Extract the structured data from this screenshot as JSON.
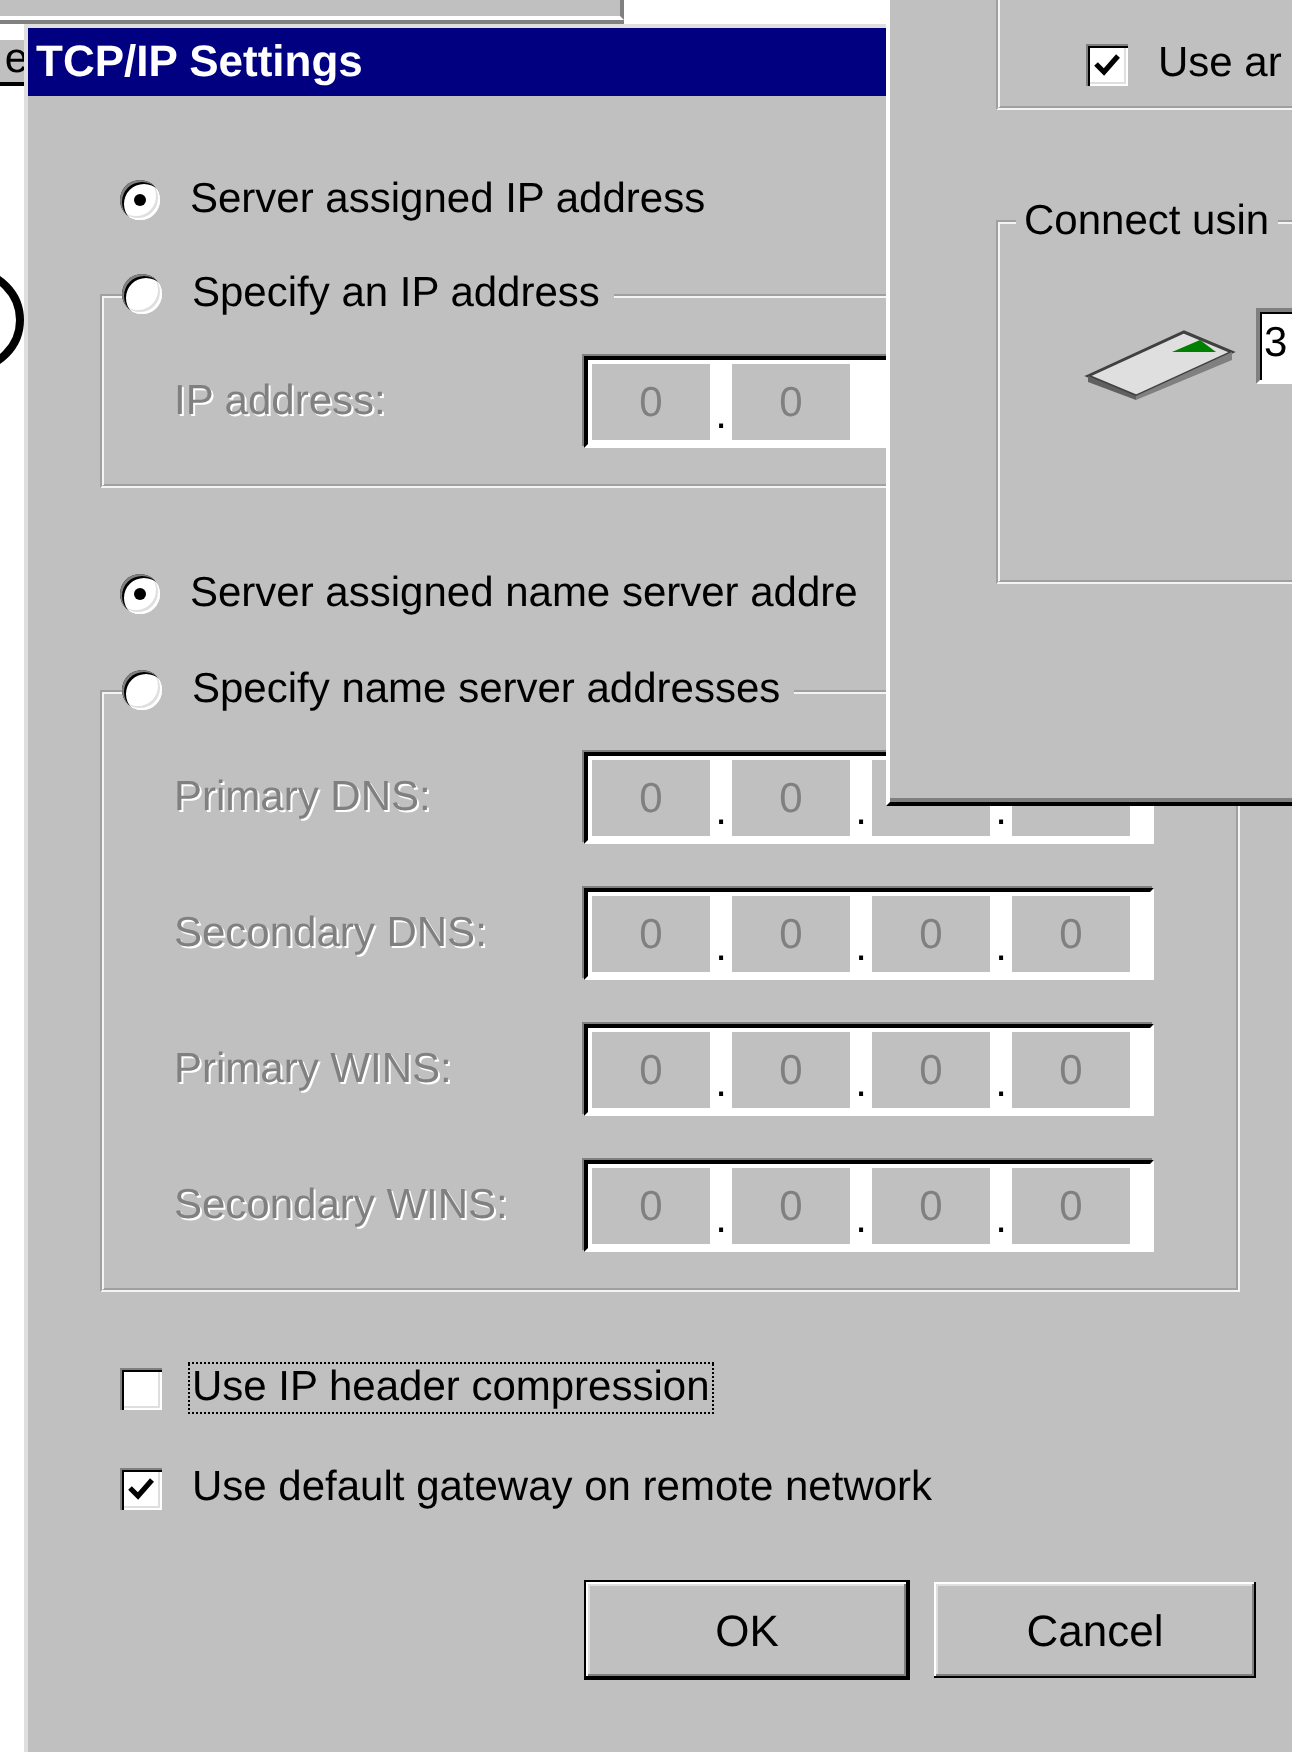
{
  "background_window": {
    "button": "e"
  },
  "dialog": {
    "title": "TCP/IP Settings",
    "ip_options": [
      {
        "label": "Server assigned IP address",
        "selected": true
      },
      {
        "label": "Specify an IP address",
        "selected": false
      }
    ],
    "ip_fields": [
      {
        "label": "IP address:",
        "disabled": true,
        "values": [
          "0",
          "0"
        ],
        "dots": [
          "."
        ]
      }
    ],
    "dns_options": [
      {
        "label": "Server assigned name server addre",
        "selected": true
      },
      {
        "label": "Specify name server addresses",
        "selected": false
      }
    ],
    "dns_fields": [
      {
        "label": "Primary DNS:",
        "disabled": true,
        "values": [
          "0",
          "0"
        ],
        "dots": [
          ".",
          ".",
          "."
        ]
      },
      {
        "label": "Secondary DNS:",
        "disabled": true,
        "values": [
          "0",
          "0",
          "0",
          "0"
        ],
        "dots": [
          ".",
          ".",
          "."
        ]
      },
      {
        "label": "Primary WINS:",
        "disabled": true,
        "values": [
          "0",
          "0",
          "0",
          "0"
        ],
        "dots": [
          ".",
          ".",
          "."
        ]
      },
      {
        "label": "Secondary WINS:",
        "disabled": true,
        "values": [
          "0",
          "0",
          "0",
          "0"
        ],
        "dots": [
          ".",
          ".",
          "."
        ]
      }
    ],
    "checkboxes": [
      {
        "label": "Use IP header compression",
        "checked": false,
        "focused": true
      },
      {
        "label": "Use default gateway on remote network",
        "checked": true,
        "focused": false
      }
    ],
    "buttons": [
      {
        "label": "OK",
        "default": true
      },
      {
        "label": "Cancel",
        "default": false
      }
    ]
  },
  "front_window": {
    "checkbox": {
      "label": "Use ar",
      "checked": true
    },
    "group_title": "Connect usin",
    "device_field": "3"
  }
}
